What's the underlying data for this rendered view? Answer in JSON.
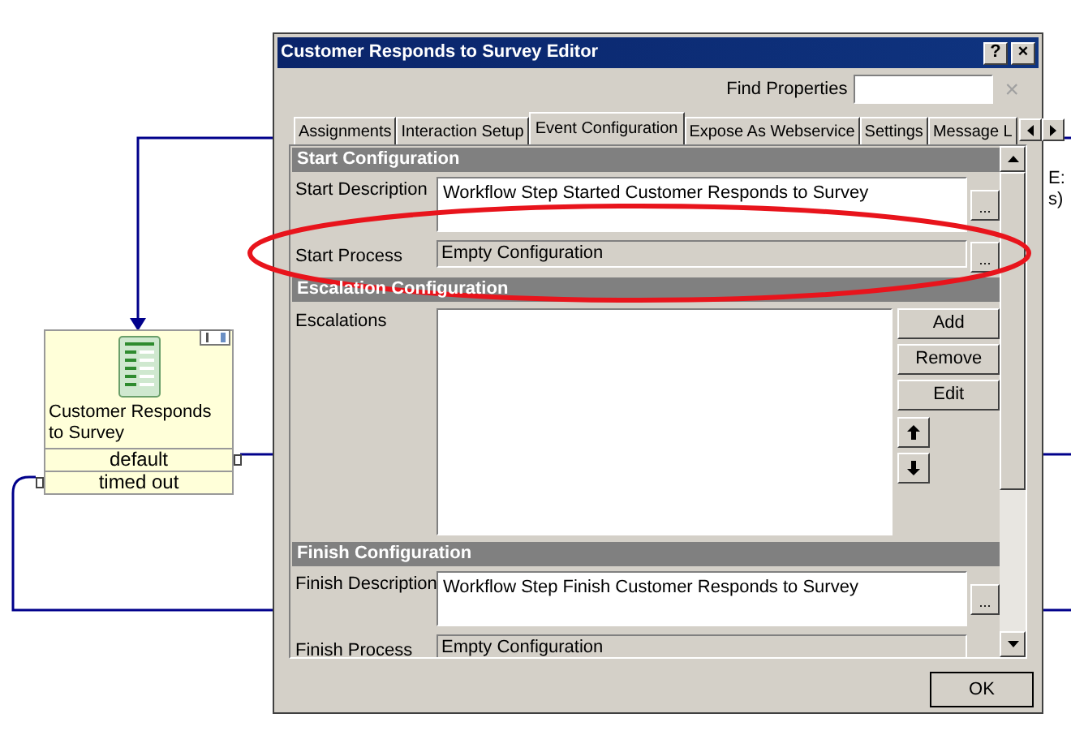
{
  "diagram": {
    "node": {
      "title": "Customer Responds to Survey",
      "outputs": [
        "default",
        "timed out"
      ]
    },
    "cut_text": [
      "E:",
      "s)"
    ]
  },
  "dialog": {
    "title": "Customer Responds to Survey Editor",
    "title_buttons": [
      "?",
      "×"
    ],
    "find": {
      "label": "Find Properties",
      "clear": "×"
    },
    "tabs": [
      {
        "label": "Assignments",
        "selected": false
      },
      {
        "label": "Interaction Setup",
        "selected": false
      },
      {
        "label": "Event Configuration",
        "selected": true
      },
      {
        "label": "Expose As Webservice",
        "selected": false
      },
      {
        "label": "Settings",
        "selected": false
      },
      {
        "label": "Message L",
        "selected": false
      }
    ],
    "sections": [
      {
        "title": "Start Configuration",
        "rows": [
          {
            "kind": "text_area",
            "label": "Start Description",
            "value": "Workflow Step Started Customer Responds to Survey",
            "button": "..."
          },
          {
            "kind": "field",
            "label": "Start Process",
            "value": "Empty Configuration",
            "button": "..."
          }
        ]
      },
      {
        "title": "Escalation Configuration",
        "rows": [
          {
            "kind": "list",
            "label": "Escalations",
            "buttons": [
              "Add",
              "Remove",
              "Edit"
            ]
          }
        ]
      },
      {
        "title": "Finish Configuration",
        "rows": [
          {
            "kind": "text_area",
            "label": "Finish Description",
            "value": "Workflow Step Finish Customer Responds to Survey",
            "button": "..."
          },
          {
            "kind": "field",
            "label": "Finish Process",
            "value": "Empty Configuration"
          }
        ]
      }
    ],
    "ok": "OK"
  }
}
